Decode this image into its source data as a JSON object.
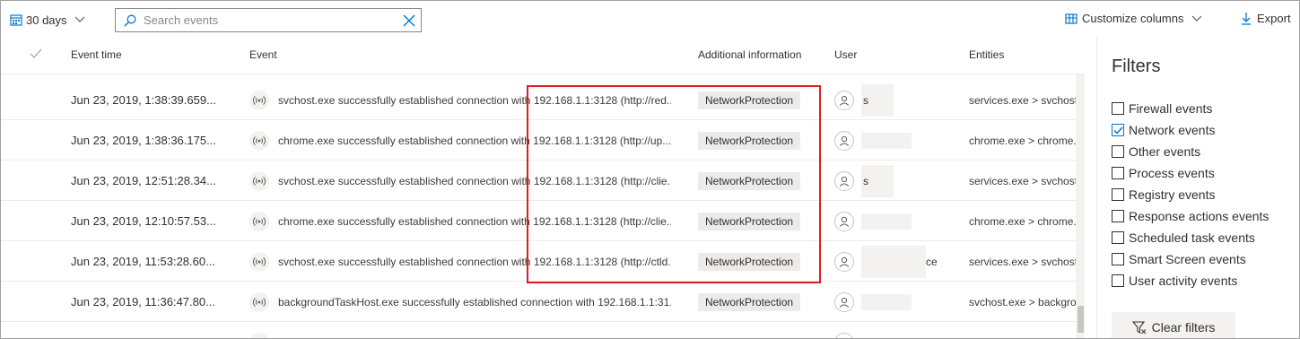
{
  "toolbar": {
    "range_label": "30 days",
    "search_placeholder": "Search events",
    "customize_label": "Customize columns",
    "export_label": "Export"
  },
  "columns": {
    "event_time": "Event time",
    "event": "Event",
    "additional_info": "Additional information",
    "user": "User",
    "entities": "Entities"
  },
  "rows": [
    {
      "time": "Jun 23, 2019, 1:38:39.659...",
      "event": "svchost.exe successfully established connection with 192.168.1.1:3128 (http://red...",
      "info": "NetworkProtection",
      "user": "s",
      "entities": "services.exe > svchost.exe"
    },
    {
      "time": "Jun 23, 2019, 1:38:36.175...",
      "event": "chrome.exe successfully established connection with 192.168.1.1:3128 (http://up...",
      "info": "NetworkProtection",
      "user": "",
      "entities": "chrome.exe > chrome.exe"
    },
    {
      "time": "Jun 23, 2019, 12:51:28.34...",
      "event": "svchost.exe successfully established connection with 192.168.1.1:3128 (http://clie...",
      "info": "NetworkProtection",
      "user": "s",
      "entities": "services.exe > svchost.exe"
    },
    {
      "time": "Jun 23, 2019, 12:10:57.53...",
      "event": "chrome.exe successfully established connection with 192.168.1.1:3128 (http://clie...",
      "info": "NetworkProtection",
      "user": "",
      "entities": "chrome.exe > chrome.exe"
    },
    {
      "time": "Jun 23, 2019, 11:53:28.60...",
      "event": "svchost.exe successfully established connection with 192.168.1.1:3128 (http://ctld...",
      "info": "NetworkProtection",
      "user": "ce",
      "entities": "services.exe > svchost.exe"
    },
    {
      "time": "Jun 23, 2019, 11:36:47.80...",
      "event": "backgroundTaskHost.exe successfully established connection with 192.168.1.1:31...",
      "info": "NetworkProtection",
      "user": "",
      "entities": "svchost.exe > backgroundT"
    }
  ],
  "filters": {
    "title": "Filters",
    "items": [
      {
        "label": "Firewall events",
        "checked": false
      },
      {
        "label": "Network events",
        "checked": true
      },
      {
        "label": "Other events",
        "checked": false
      },
      {
        "label": "Process events",
        "checked": false
      },
      {
        "label": "Registry events",
        "checked": false
      },
      {
        "label": "Response actions events",
        "checked": false
      },
      {
        "label": "Scheduled task events",
        "checked": false
      },
      {
        "label": "Smart Screen events",
        "checked": false
      },
      {
        "label": "User activity events",
        "checked": false
      }
    ],
    "clear_label": "Clear filters"
  },
  "colors": {
    "accent": "#0078d4",
    "highlight": "#e01b24",
    "badge_bg": "#edebe9"
  }
}
